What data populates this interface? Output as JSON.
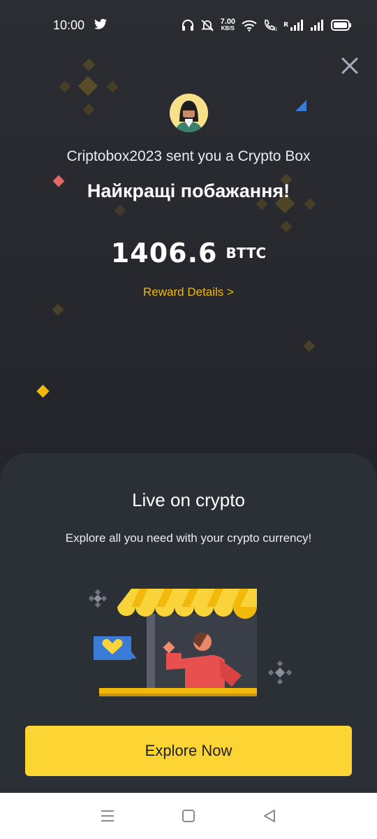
{
  "status_bar": {
    "time": "10:00",
    "net_speed_value": "7.00",
    "net_speed_unit": "KB/S",
    "roaming_label": "R",
    "icons": [
      "twitter-icon",
      "headset-icon",
      "mute-icon",
      "wifi-icon",
      "call-icon",
      "signal-icon",
      "signal-icon",
      "battery-icon"
    ]
  },
  "gift": {
    "sender_message": "Criptobox2023 sent you a Crypto Box",
    "wish": "Найкращі побажання!",
    "amount": "1406.6",
    "currency": "BTTC",
    "reward_link": "Reward Details >"
  },
  "promo": {
    "title": "Live on crypto",
    "subtitle": "Explore all you need with your crypto currency!",
    "button_label": "Explore Now"
  },
  "colors": {
    "accent": "#F0B90B",
    "button": "#FCD535",
    "background": "#24272D",
    "card": "#2B2F36"
  }
}
